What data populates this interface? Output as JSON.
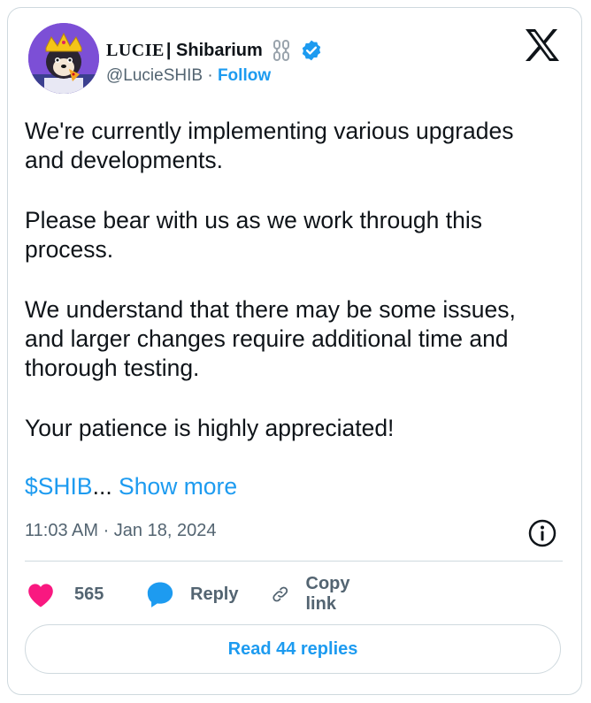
{
  "author": {
    "name_brand": "LUCIE",
    "name_rest": " | Shibarium",
    "handle": "@LucieSHIB",
    "separator": "·",
    "follow_label": "Follow"
  },
  "icons": {
    "avatar": "shiba-king-avatar",
    "chain": "chain-link-icon",
    "verified": "verified-badge-icon",
    "platform": "x-logo-icon",
    "info": "info-icon",
    "like": "heart-icon",
    "reply": "reply-bubble-icon",
    "copy": "link-icon"
  },
  "tweet": {
    "paragraphs": [
      "We're currently implementing various upgrades and developments.",
      "Please bear with us as we work through this process.",
      "We understand that there may be some issues, and larger changes require additional time and thorough testing.",
      "Your patience is highly appreciated!"
    ],
    "cashtag": "$SHIB",
    "ellipsis": "...",
    "show_more": " Show more",
    "timestamp": "11:03 AM · Jan 18, 2024"
  },
  "actions": {
    "like_count": "565",
    "reply_label": "Reply",
    "copy_label": "Copy link",
    "read_replies_label": "Read 44 replies"
  },
  "colors": {
    "accent": "#1d9bf0",
    "like": "#f91880",
    "text": "#0f1419",
    "secondary": "#536471",
    "border": "#cfd9de",
    "avatar_bg": "#7c4fd6"
  }
}
